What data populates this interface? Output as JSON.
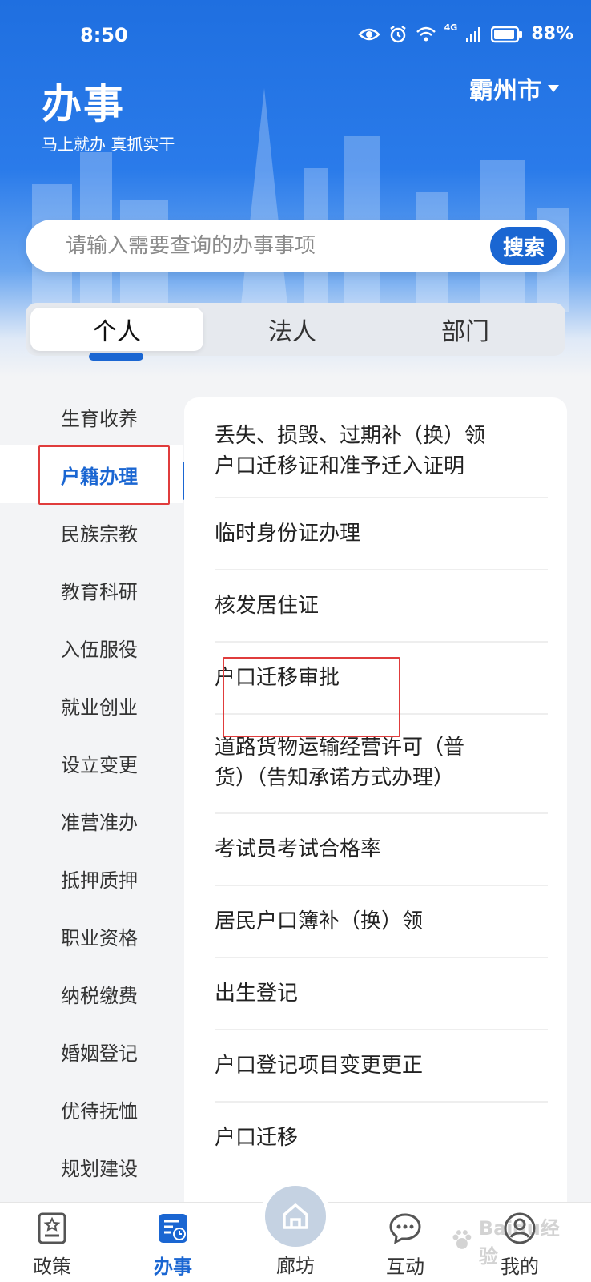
{
  "status_bar": {
    "time": "8:50",
    "network_label": "4G",
    "battery": "88%"
  },
  "header": {
    "title": "办事",
    "slogan": "马上就办  真抓实干",
    "city": "霸州市"
  },
  "search": {
    "placeholder": "请输入需要查询的办事事项",
    "button_label": "搜索"
  },
  "tabs": [
    {
      "label": "个人",
      "active": true
    },
    {
      "label": "法人",
      "active": false
    },
    {
      "label": "部门",
      "active": false
    }
  ],
  "sidebar": {
    "items": [
      {
        "label": "生育收养"
      },
      {
        "label": "户籍办理",
        "active": true
      },
      {
        "label": "民族宗教"
      },
      {
        "label": "教育科研"
      },
      {
        "label": "入伍服役"
      },
      {
        "label": "就业创业"
      },
      {
        "label": "设立变更"
      },
      {
        "label": "准营准办"
      },
      {
        "label": "抵押质押"
      },
      {
        "label": "职业资格"
      },
      {
        "label": "纳税缴费"
      },
      {
        "label": "婚姻登记"
      },
      {
        "label": "优待抚恤"
      },
      {
        "label": "规划建设"
      }
    ]
  },
  "services": [
    {
      "line1": "丢失、损毁、过期补（换）领",
      "line2": "户口迁移证和准予迁入证明"
    },
    {
      "line1": "临时身份证办理",
      "line2": ""
    },
    {
      "line1": "核发居住证",
      "line2": ""
    },
    {
      "line1": "户口迁移审批",
      "line2": ""
    },
    {
      "line1": "道路货物运输经营许可（普",
      "line2": "货）（告知承诺方式办理）"
    },
    {
      "line1": "考试员考试合格率",
      "line2": ""
    },
    {
      "line1": "居民户口簿补（换）领",
      "line2": ""
    },
    {
      "line1": "出生登记",
      "line2": ""
    },
    {
      "line1": "户口登记项目变更更正",
      "line2": ""
    },
    {
      "line1": "户口迁移",
      "line2": ""
    }
  ],
  "bottom_nav": {
    "items": [
      {
        "label": "政策",
        "icon": "policy-icon"
      },
      {
        "label": "办事",
        "icon": "affairs-icon",
        "active": true
      },
      {
        "label": "廊坊",
        "icon": "home-icon"
      },
      {
        "label": "互动",
        "icon": "chat-icon"
      },
      {
        "label": "我的",
        "icon": "user-icon"
      }
    ]
  },
  "watermark": "Baidu经验",
  "colors": {
    "accent": "#1a66d2",
    "annotation": "#e03c3c",
    "header_blue": "#1f6fe0"
  }
}
